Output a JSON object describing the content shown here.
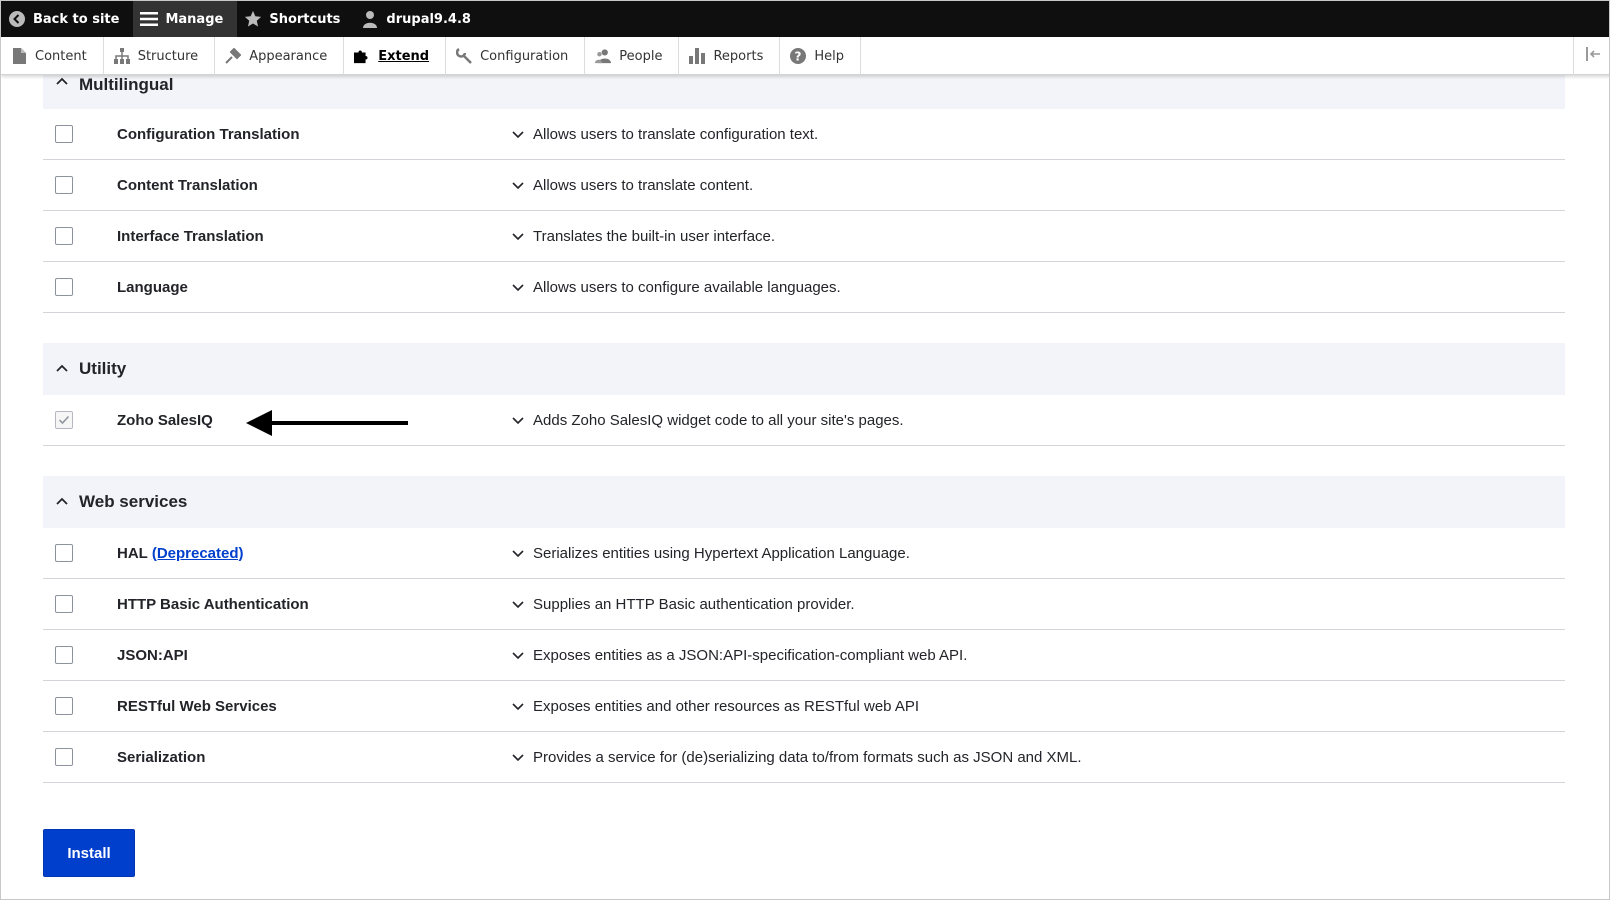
{
  "toolbar": {
    "back_label": "Back to site",
    "manage_label": "Manage",
    "shortcuts_label": "Shortcuts",
    "user_label": "drupal9.4.8"
  },
  "tray": {
    "items": [
      {
        "label": "Content",
        "icon": "page-icon"
      },
      {
        "label": "Structure",
        "icon": "sitemap-icon"
      },
      {
        "label": "Appearance",
        "icon": "brush-icon"
      },
      {
        "label": "Extend",
        "icon": "puzzle-icon",
        "active": true
      },
      {
        "label": "Configuration",
        "icon": "wrench-icon"
      },
      {
        "label": "People",
        "icon": "people-icon"
      },
      {
        "label": "Reports",
        "icon": "bar-chart-icon"
      },
      {
        "label": "Help",
        "icon": "help-icon"
      }
    ]
  },
  "packages": [
    {
      "title": "Multilingual",
      "modules": [
        {
          "name": "Configuration Translation",
          "description": "Allows users to translate configuration text.",
          "checked": false
        },
        {
          "name": "Content Translation",
          "description": "Allows users to translate content.",
          "checked": false
        },
        {
          "name": "Interface Translation",
          "description": "Translates the built-in user interface.",
          "checked": false
        },
        {
          "name": "Language",
          "description": "Allows users to configure available languages.",
          "checked": false
        }
      ]
    },
    {
      "title": "Utility",
      "modules": [
        {
          "name": "Zoho SalesIQ",
          "description": "Adds Zoho SalesIQ widget code to all your site's pages.",
          "checked": true
        }
      ]
    },
    {
      "title": "Web services",
      "modules": [
        {
          "name": "HAL",
          "deprecated_label": "(Deprecated)",
          "description": "Serializes entities using Hypertext Application Language.",
          "checked": false
        },
        {
          "name": "HTTP Basic Authentication",
          "description": "Supplies an HTTP Basic authentication provider.",
          "checked": false
        },
        {
          "name": "JSON:API",
          "description": "Exposes entities as a JSON:API-specification-compliant web API.",
          "checked": false
        },
        {
          "name": "RESTful Web Services",
          "description": "Exposes entities and other resources as RESTful web API",
          "checked": false
        },
        {
          "name": "Serialization",
          "description": "Provides a service for (de)serializing data to/from formats such as JSON and XML.",
          "checked": false
        }
      ]
    }
  ],
  "install_label": "Install",
  "colors": {
    "toolbar_bg": "#0f0f0f",
    "primary_button": "#003ecc",
    "link": "#003ecc",
    "header_bg": "#f3f4f9"
  }
}
